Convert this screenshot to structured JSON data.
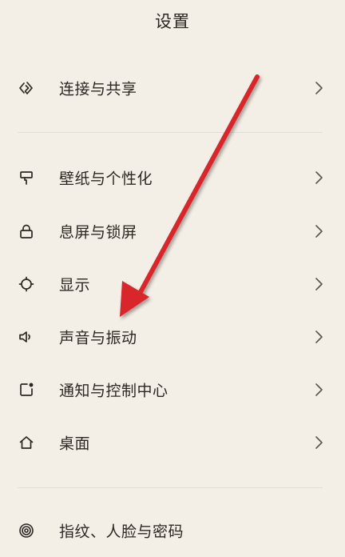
{
  "header": {
    "title": "设置"
  },
  "sections": [
    {
      "items": [
        {
          "id": "connect-share",
          "label": "连接与共享",
          "icon": "share-link-icon"
        }
      ]
    },
    {
      "items": [
        {
          "id": "wallpaper",
          "label": "壁纸与个性化",
          "icon": "paint-roller-icon"
        },
        {
          "id": "lockscreen",
          "label": "息屏与锁屏",
          "icon": "lock-icon"
        },
        {
          "id": "display",
          "label": "显示",
          "icon": "brightness-icon"
        },
        {
          "id": "sound",
          "label": "声音与振动",
          "icon": "speaker-icon"
        },
        {
          "id": "notifications",
          "label": "通知与控制中心",
          "icon": "notification-icon"
        },
        {
          "id": "desktop",
          "label": "桌面",
          "icon": "home-icon"
        }
      ]
    },
    {
      "items": [
        {
          "id": "biometrics",
          "label": "指纹、人脸与密码",
          "icon": "fingerprint-icon"
        }
      ]
    }
  ],
  "annotation": {
    "color": "#d8262a",
    "icon": "red-arrow-annotation"
  }
}
